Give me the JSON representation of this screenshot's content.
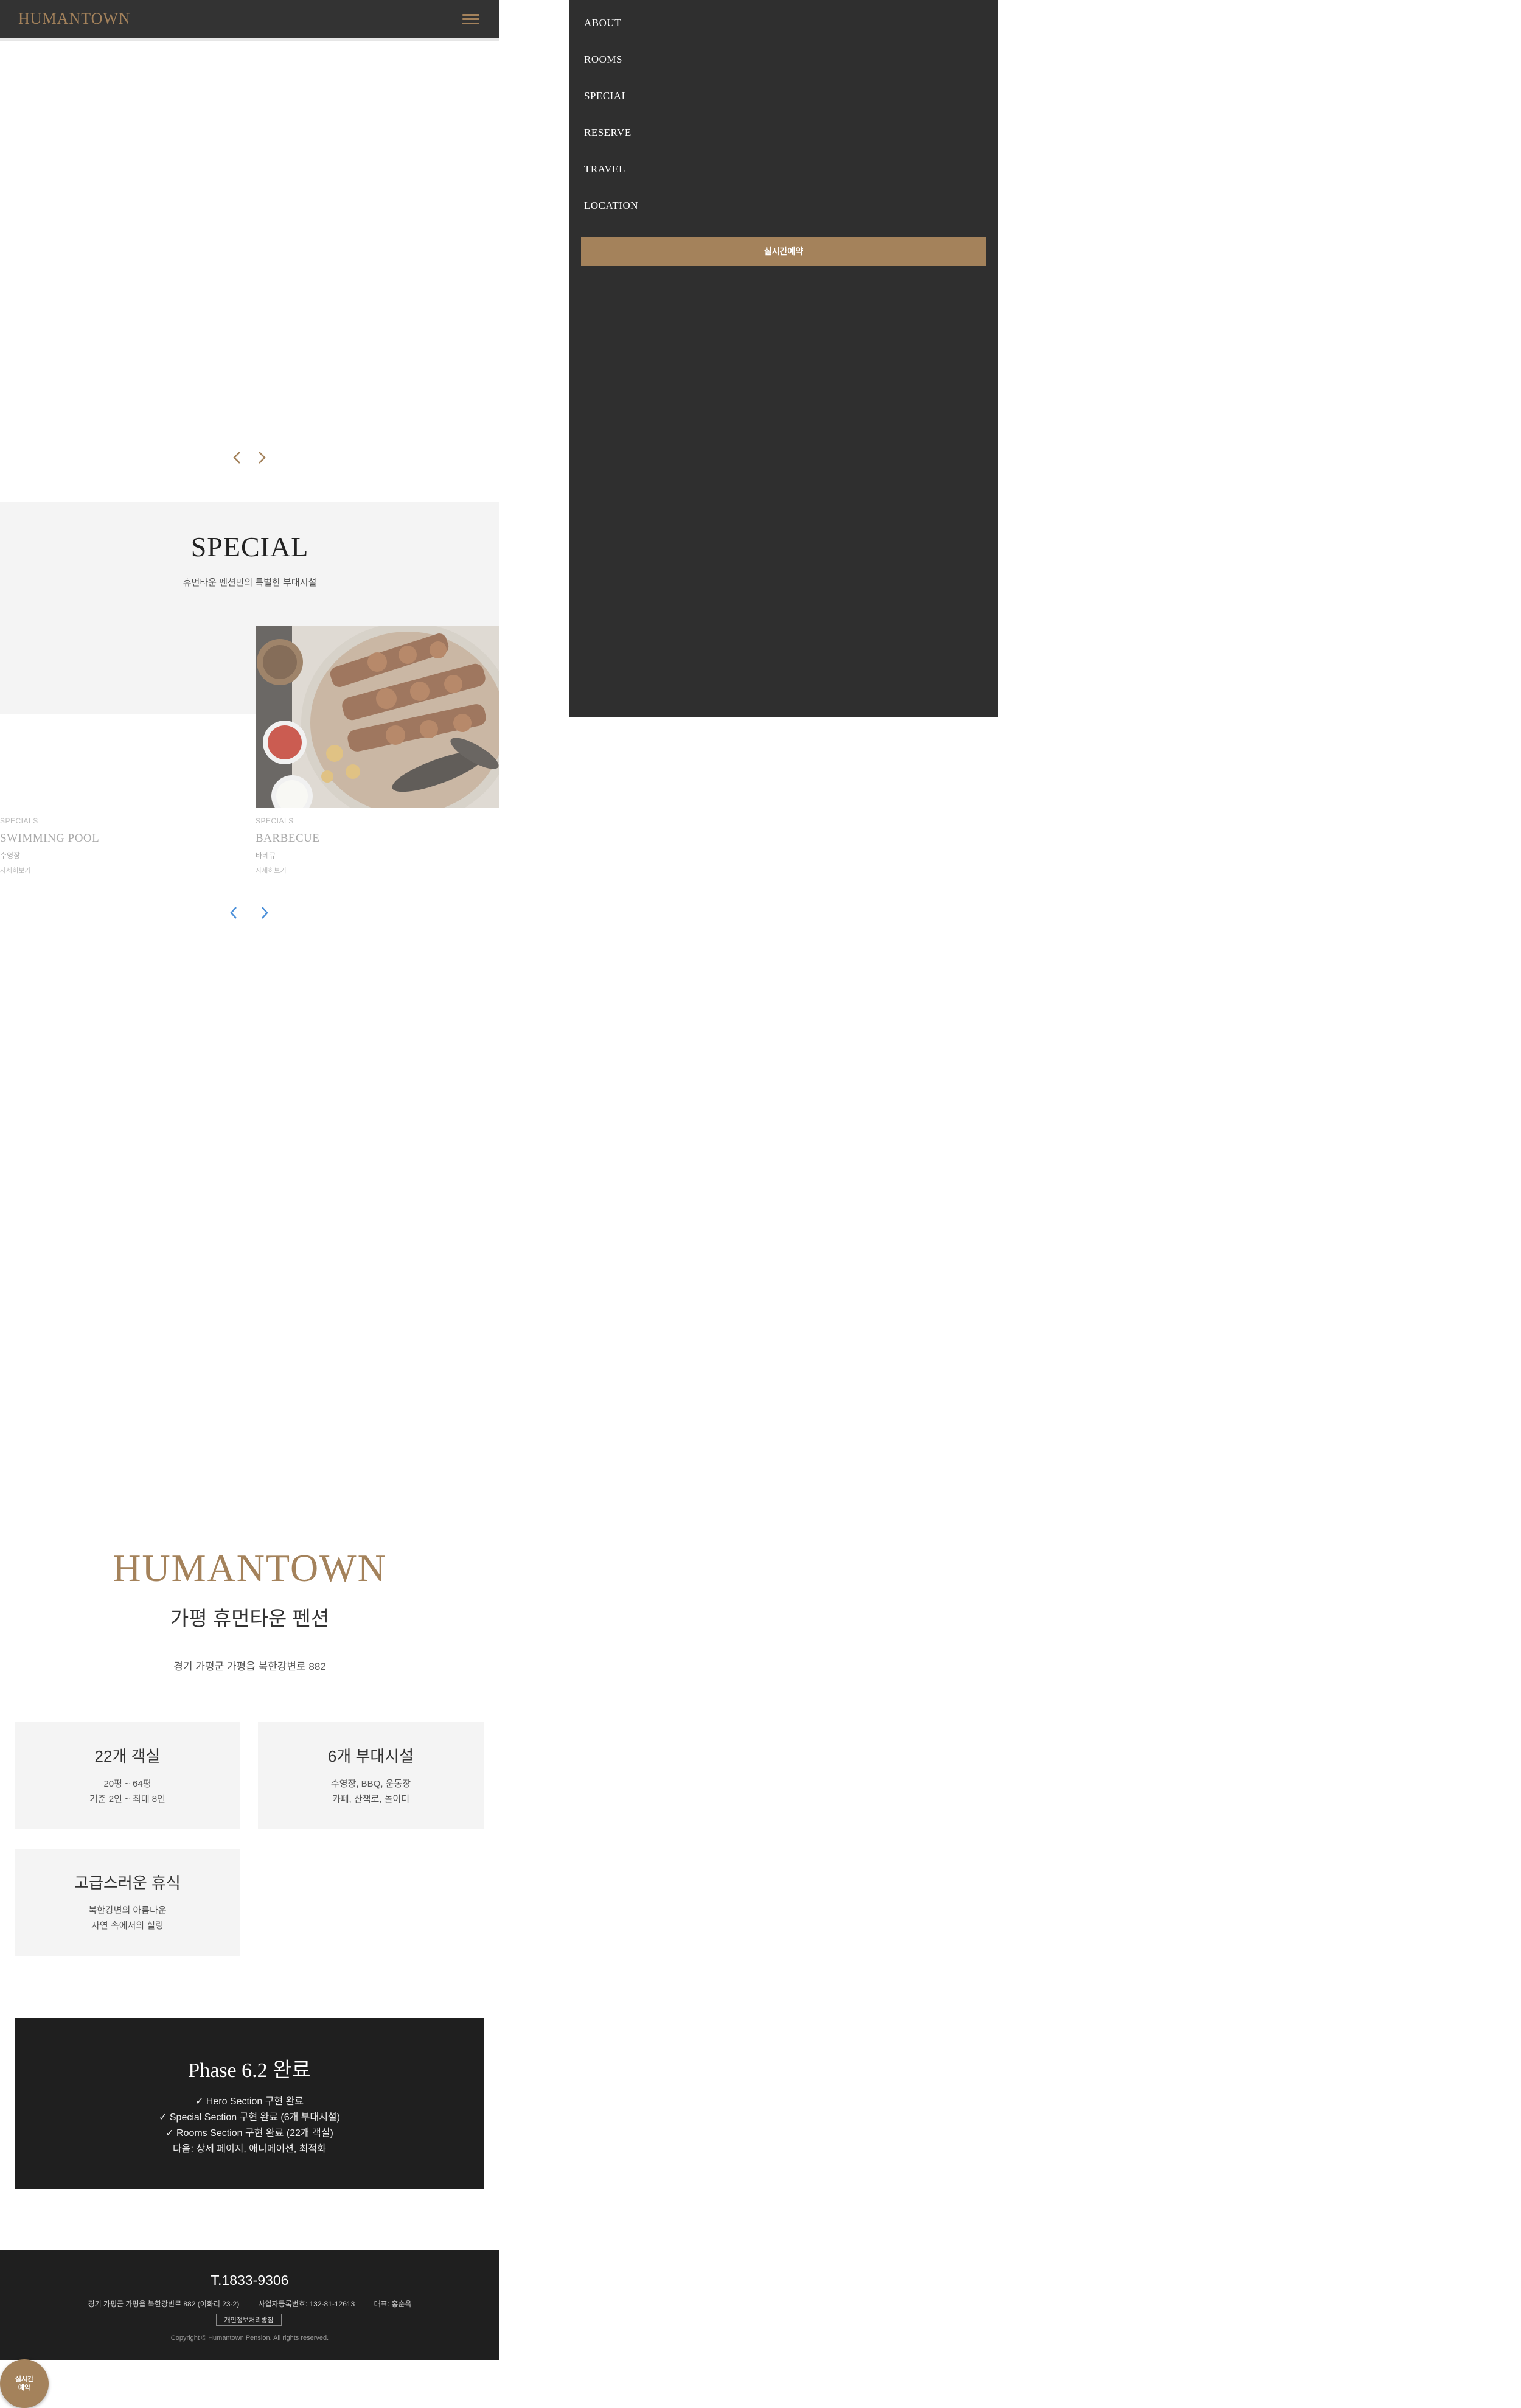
{
  "header": {
    "logo": "HUMANTOWN",
    "menu_icon": "hamburger-icon"
  },
  "hero": {
    "prev_icon": "chevron-left-icon",
    "next_icon": "chevron-right-icon"
  },
  "special": {
    "title": "SPECIAL",
    "subtitle": "휴먼타운 펜션만의 특별한 부대시설",
    "cards": [
      {
        "category": "SPECIALS",
        "name": "SWIMMING POOL",
        "desc": "수영장",
        "link": "자세히보기"
      },
      {
        "category": "SPECIALS",
        "name": "BARBECUE",
        "desc": "바베큐",
        "link": "자세히보기"
      }
    ],
    "prev_icon": "chevron-left-icon",
    "next_icon": "chevron-right-icon"
  },
  "menu": {
    "items": [
      "ABOUT",
      "ROOMS",
      "SPECIAL",
      "RESERVE",
      "TRAVEL",
      "LOCATION"
    ],
    "reserve_button": "실시간예약"
  },
  "info": {
    "logo": "HUMANTOWN",
    "title": "가평 휴먼타운 펜션",
    "address": "경기 가평군 가평읍 북한강변로 882",
    "features": [
      {
        "title": "22개 객실",
        "lines": [
          "20평 ~ 64평",
          "기준 2인 ~ 최대 8인"
        ]
      },
      {
        "title": "6개 부대시설",
        "lines": [
          "수영장, BBQ, 운동장",
          "카페, 산책로, 놀이터"
        ]
      },
      {
        "title": "고급스러운 휴식",
        "lines": [
          "북한강변의 아름다운",
          "자연 속에서의 힐링"
        ]
      }
    ]
  },
  "phase": {
    "title": "Phase 6.2 완료",
    "lines": [
      "✓ Hero Section 구현 완료",
      "✓ Special Section 구현 완료 (6개 부대시설)",
      "✓ Rooms Section 구현 완료 (22개 객실)",
      "다음: 상세 페이지, 애니메이션, 최적화"
    ]
  },
  "footer": {
    "phone": "T.1833-9306",
    "address": "경기 가평군 가평읍 북한강변로 882 (이화리 23-2)",
    "business_number": "사업자등록번호: 132-81-12613",
    "ceo": "대표: 홍순옥",
    "privacy": "개인정보처리방침",
    "copyright": "Copyright © Humantown Pension. All rights reserved."
  },
  "floating_button": {
    "line1": "실시간",
    "line2": "예약"
  },
  "colors": {
    "accent": "#a4825b",
    "dark": "#333333",
    "menu_bg": "#2f2f2f",
    "section_bg": "#f4f4f4",
    "footer_bg": "#1f1f1f",
    "link_blue": "#4a8fd9"
  }
}
